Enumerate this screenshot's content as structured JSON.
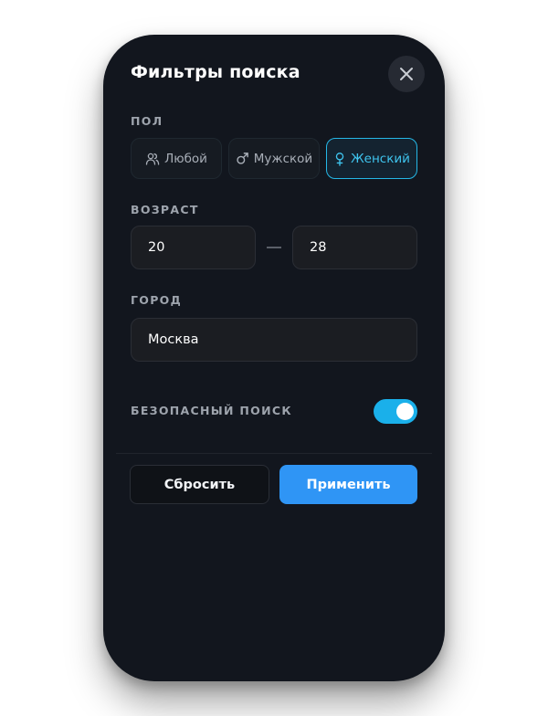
{
  "header": {
    "title": "Фильтры поиска"
  },
  "gender": {
    "label": "ПОЛ",
    "options": [
      {
        "label": "Любой",
        "icon": "users-icon",
        "selected": false
      },
      {
        "label": "Мужской",
        "icon": "male-symbol-icon",
        "selected": false
      },
      {
        "label": "Женский",
        "icon": "female-symbol-icon",
        "selected": true
      }
    ]
  },
  "age": {
    "label": "ВОЗРАСТ",
    "from": "20",
    "to": "28"
  },
  "city": {
    "label": "ГОРОД",
    "value": "Москва"
  },
  "safe_search": {
    "label": "БЕЗОПАСНЫЙ ПОИСК",
    "enabled": true
  },
  "actions": {
    "reset_label": "Сбросить",
    "apply_label": "Применить"
  },
  "colors": {
    "background": "#12161e",
    "accent": "#2f95f5",
    "active_chip": "#25b7e6",
    "toggle_on": "#1ab0ea"
  }
}
